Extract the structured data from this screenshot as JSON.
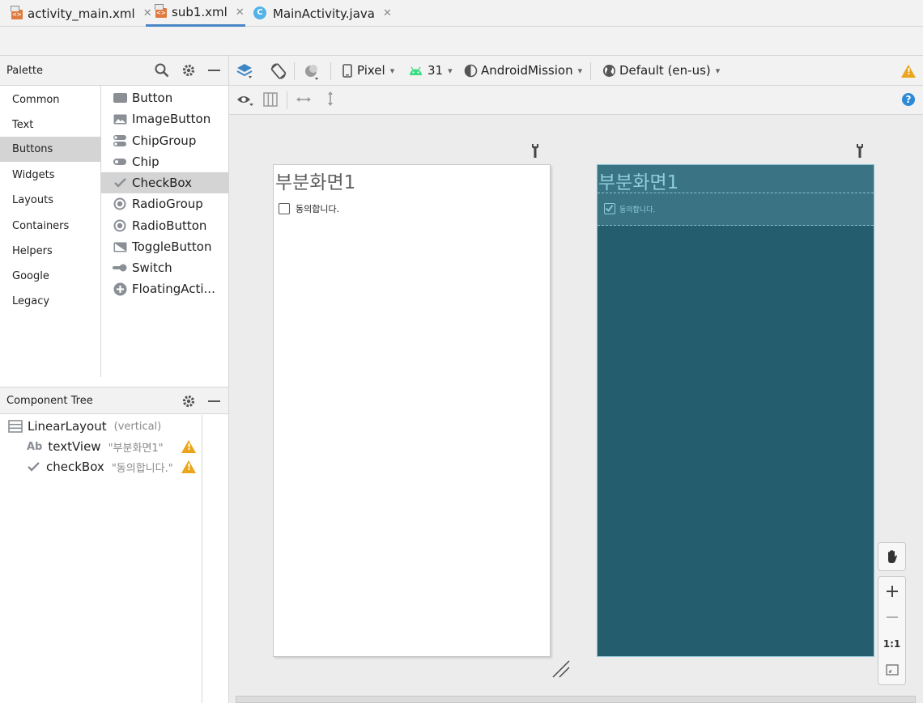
{
  "tabs": [
    {
      "label": "activity_main.xml",
      "type": "xml",
      "active": false
    },
    {
      "label": "sub1.xml",
      "type": "xml",
      "active": true
    },
    {
      "label": "MainActivity.java",
      "type": "java",
      "active": false
    }
  ],
  "palette": {
    "title": "Palette",
    "categories": [
      "Common",
      "Text",
      "Buttons",
      "Widgets",
      "Layouts",
      "Containers",
      "Helpers",
      "Google",
      "Legacy"
    ],
    "selected_category": "Buttons",
    "items": [
      "Button",
      "ImageButton",
      "ChipGroup",
      "Chip",
      "CheckBox",
      "RadioGroup",
      "RadioButton",
      "ToggleButton",
      "Switch",
      "FloatingActi..."
    ],
    "selected_item": "CheckBox"
  },
  "component_tree": {
    "title": "Component Tree",
    "root": {
      "name": "LinearLayout",
      "detail": "(vertical)"
    },
    "children": [
      {
        "icon": "Ab",
        "name": "textView",
        "detail": "\"부분화면1\"",
        "warning": true
      },
      {
        "icon": "check",
        "name": "checkBox",
        "detail": "\"동의합니다.\"",
        "warning": true
      }
    ]
  },
  "toolbar": {
    "device": "Pixel",
    "api": "31",
    "theme": "AndroidMission",
    "locale": "Default (en-us)"
  },
  "design": {
    "title_text": "부분화면1",
    "checkbox_text": "동의합니다."
  },
  "zoom": {
    "reset_label": "1:1"
  },
  "colors": {
    "accent": "#4a86c7",
    "blueprint_bg": "#245d6d",
    "blueprint_line": "#8bc1cf",
    "warning": "#eba51d",
    "android_green": "#3ddc84"
  }
}
